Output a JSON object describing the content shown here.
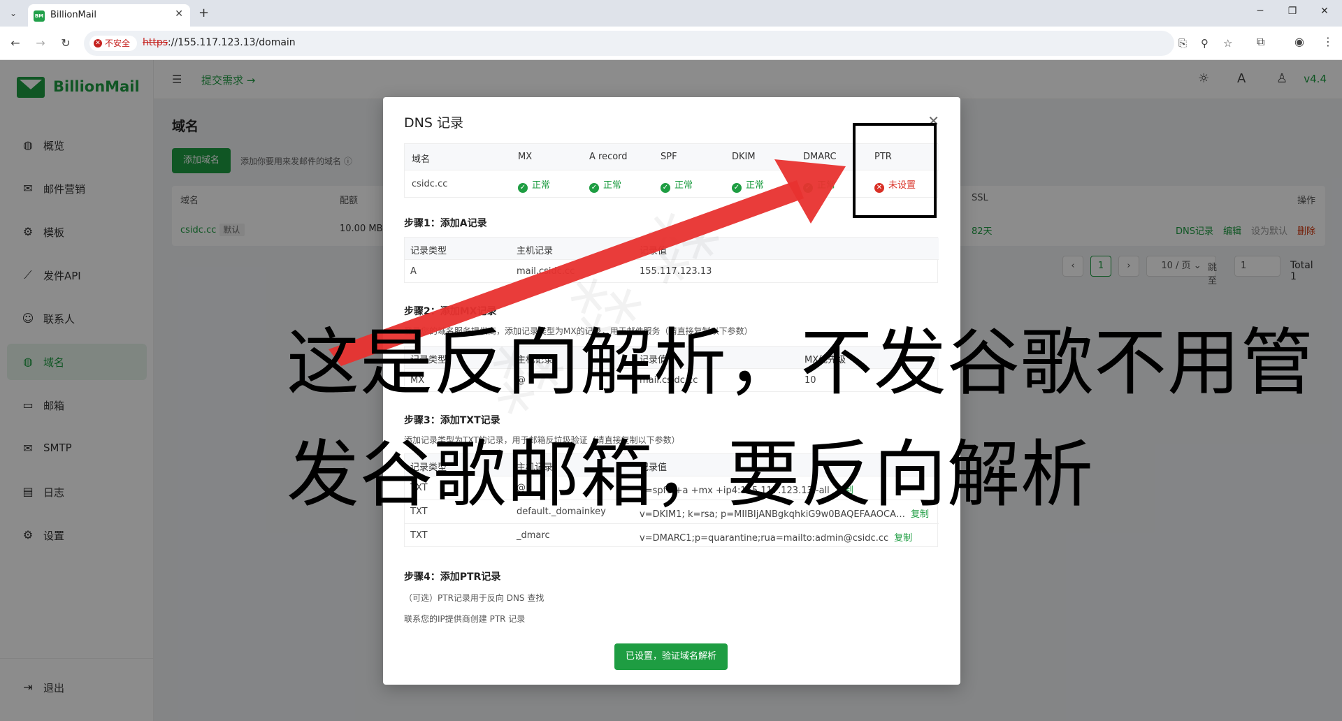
{
  "browser": {
    "tab_title": "BillionMail",
    "tab_favicon": "BM",
    "insecure_label": "不安全",
    "url_scheme": "https",
    "url_rest": "://155.117.123.13/domain"
  },
  "app": {
    "logo_text": "BillionMail",
    "submit_link": "提交需求 →",
    "version": "v4.4",
    "sidebar": {
      "items": [
        {
          "label": "概览",
          "icon": "globe-icon"
        },
        {
          "label": "邮件营销",
          "icon": "campaign-icon"
        },
        {
          "label": "模板",
          "icon": "gear-icon"
        },
        {
          "label": "发件API",
          "icon": "chart-icon"
        },
        {
          "label": "联系人",
          "icon": "contacts-icon"
        },
        {
          "label": "域名",
          "icon": "globe-icon"
        },
        {
          "label": "邮箱",
          "icon": "inbox-icon"
        },
        {
          "label": "SMTP",
          "icon": "mail-icon"
        },
        {
          "label": "日志",
          "icon": "log-icon"
        },
        {
          "label": "设置",
          "icon": "gear-icon"
        }
      ],
      "logout": "退出"
    },
    "page": {
      "title": "域名",
      "add_button": "添加域名",
      "add_hint": "添加你要用来发邮件的域名",
      "columns": {
        "domain": "域名",
        "quota": "配额",
        "ssl": "SSL",
        "actions": "操作"
      },
      "row": {
        "domain": "csidc.cc",
        "default_tag": "默认",
        "quota": "10.00 MB",
        "ssl": "82天",
        "action_dns": "DNS记录",
        "action_edit": "编辑",
        "action_default": "设为默认",
        "action_delete": "删除"
      },
      "pager": {
        "current": "1",
        "page_size": "10 / 页",
        "jump_label": "跳至",
        "jump_value": "1",
        "total": "Total 1"
      }
    }
  },
  "modal": {
    "title": "DNS 记录",
    "status_table": {
      "headers": [
        "域名",
        "MX",
        "A record",
        "SPF",
        "DKIM",
        "DMARC",
        "PTR"
      ],
      "domain": "csidc.cc",
      "ok_text": "正常",
      "ptr_text": "未设置"
    },
    "step1": {
      "title": "步骤1：添加A记录",
      "headers": [
        "记录类型",
        "主机记录",
        "记录值"
      ],
      "rows": [
        [
          "A",
          "mail.csidc.cc",
          "155.117.123.13"
        ]
      ]
    },
    "step2": {
      "title": "步骤2：添加MX记录",
      "desc": "登录您的域名服务提供商，添加记录类型为MX的记录，用于邮件服务（请直接复制以下参数）",
      "headers": [
        "记录类型",
        "主机记录",
        "记录值",
        "MX优先级"
      ],
      "rows": [
        [
          "MX",
          "@",
          "mail.csidc.cc",
          "10"
        ]
      ]
    },
    "step3": {
      "title": "步骤3：添加TXT记录",
      "desc": "添加记录类型为TXT的记录，用于邮箱反垃圾验证（请直接复制以下参数）",
      "headers": [
        "记录类型",
        "主机记录",
        "记录值"
      ],
      "rows": [
        [
          "TXT",
          "@",
          "v=spf1 +a +mx +ip4:155.117.123.13 -all"
        ],
        [
          "TXT",
          "default._domainkey",
          "v=DKIM1; k=rsa; p=MIIBIjANBgkqhkiG9w0BAQEFAAOCA…"
        ],
        [
          "TXT",
          "_dmarc",
          "v=DMARC1;p=quarantine;rua=mailto:admin@csidc.cc"
        ]
      ],
      "copy": "复制"
    },
    "step4": {
      "title": "步骤4：添加PTR记录",
      "line1": "（可选）PTR记录用于反向 DNS 查找",
      "line2": "联系您的IP提供商创建 PTR 记录"
    },
    "verify_button": "已设置，验证域名解析"
  },
  "annotation": {
    "caption_line1": "这是反向解析，不发谷歌不用管",
    "caption_line2": "发谷歌邮箱，要反向解析",
    "arrow_color": "#e8312f"
  }
}
